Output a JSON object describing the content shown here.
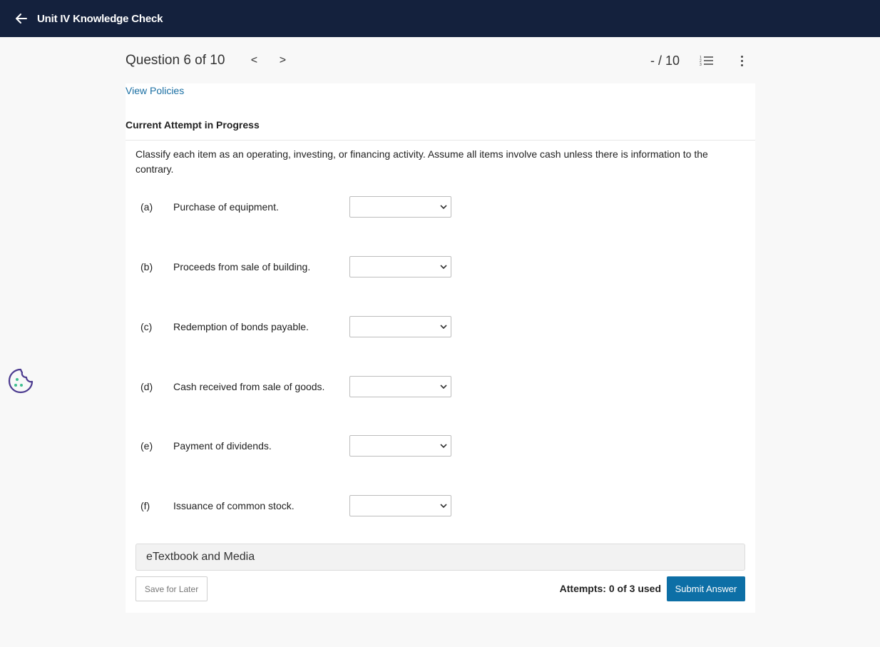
{
  "header": {
    "back_icon": "arrow-left-icon",
    "title": "Unit IV Knowledge Check"
  },
  "question_nav": {
    "question_label": "Question 6 of 10",
    "prev_label": "<",
    "next_label": ">",
    "score": "- / 10",
    "list_icon": "numbered-list-icon",
    "more_icon": "kebab-menu-icon"
  },
  "content": {
    "policies_link": "View Policies",
    "attempt_header": "Current Attempt in Progress",
    "prompt": "Classify each item as an operating, investing, or financing activity. Assume all items involve cash unless there is information to the contrary.",
    "items": [
      {
        "letter": "(a)",
        "text": "Purchase of equipment.",
        "selected": ""
      },
      {
        "letter": "(b)",
        "text": "Proceeds from sale of building.",
        "selected": ""
      },
      {
        "letter": "(c)",
        "text": "Redemption of bonds payable.",
        "selected": ""
      },
      {
        "letter": "(d)",
        "text": "Cash received from sale of goods.",
        "selected": ""
      },
      {
        "letter": "(e)",
        "text": "Payment of dividends.",
        "selected": ""
      },
      {
        "letter": "(f)",
        "text": "Issuance of common stock.",
        "selected": ""
      }
    ],
    "etextbook": "eTextbook and Media"
  },
  "footer": {
    "save_label": "Save for Later",
    "attempts_text": "Attempts: 0 of 3 used",
    "submit_label": "Submit Answer"
  },
  "colors": {
    "header_bg": "#14213d",
    "link": "#1a6fa3",
    "primary_button": "#0d6fa6",
    "cookie_icon": "#4b3a8f"
  },
  "cookie_icon": "cookie-icon"
}
